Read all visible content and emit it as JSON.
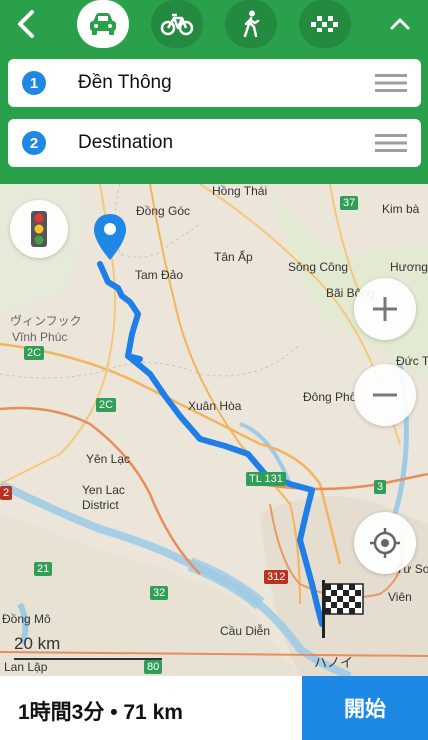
{
  "transport_modes": [
    {
      "name": "car",
      "active": true
    },
    {
      "name": "bicycle",
      "active": false
    },
    {
      "name": "walk",
      "active": false
    },
    {
      "name": "taxi",
      "active": false
    }
  ],
  "route": {
    "origin": {
      "index": "1",
      "label": "Đền Thông"
    },
    "destination": {
      "index": "2",
      "label": "Destination"
    }
  },
  "map": {
    "place_labels": {
      "hong_thai": "Hồng Thái",
      "dong_goc": "Đồng Góc",
      "tan_ap": "Tân Ấp",
      "song_cong": "Sông Công",
      "kim_ba": "Kim bà",
      "tam_dao": "Tam Đảo",
      "huong": "Hương",
      "bai_bong": "Bãi Bông",
      "vinh_phuc_jp": "ヴィンフック",
      "vinh_phuc": "Vĩnh Phúc",
      "duc_t": "Đức T",
      "xuan_hoa": "Xuân Hòa",
      "dong_pho": "Đông Phố",
      "yen_lac": "Yên Lạc",
      "yen_lac_district_1": "Yen Lac",
      "yen_lac_district_2": "District",
      "tu_so": "Tư Sơ",
      "viet": "Viên",
      "dong_mo": "Đồng Mô",
      "cau_dien": "Cầu Diễn",
      "lan_lap": "Lan Lập",
      "hanoi": "ハノイ"
    },
    "road_labels": {
      "r37": "37",
      "r2c_1": "2C",
      "r2c_2": "2C",
      "r2": "2",
      "r21": "21",
      "r32": "32",
      "r80": "80",
      "r312": "312",
      "tl131": "TL 131",
      "r3": "3"
    },
    "scale_label": "20 km"
  },
  "summary": "1時間3分 • 71 km",
  "start_label": "開始",
  "colors": {
    "header": "#2aa04a",
    "accent": "#1e88e5",
    "route": "#1f7fe6"
  }
}
